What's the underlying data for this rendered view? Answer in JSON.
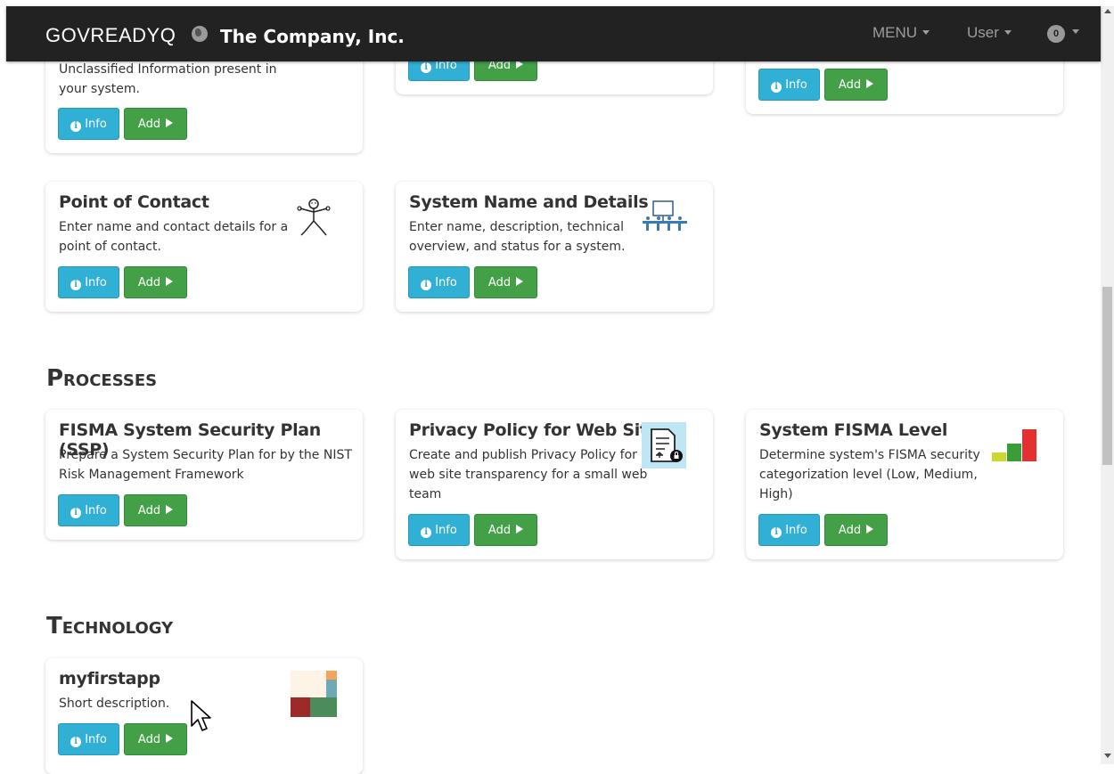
{
  "navbar": {
    "brand": "GOVREADYQ",
    "company": "The Company, Inc.",
    "menu_label": "MENU",
    "user_label": "User",
    "notifications_count": "0"
  },
  "buttons": {
    "info_label": "Info",
    "add_label": "Add"
  },
  "top_row": [
    {
      "desc_line1": "Unclassified Information present in",
      "desc_line2": "your system."
    }
  ],
  "row2": [
    {
      "title": "Point of Contact",
      "desc": [
        "Enter name and contact details for a",
        "point of contact."
      ],
      "icon": "stick-figure-icon"
    },
    {
      "title": "System Name and Details",
      "desc": [
        "Enter name, description, technical",
        "overview, and status for a system."
      ],
      "icon": "whiteboard-meeting-icon"
    }
  ],
  "sections": {
    "processes": "Processes",
    "technology": "Technology"
  },
  "processes": [
    {
      "title": "FISMA System Security Plan (SSP)",
      "desc": [
        "Prepare a System Security Plan for by the NIST",
        "Risk Management Framework"
      ]
    },
    {
      "title": "Privacy Policy for Web Site",
      "desc": [
        "Create and publish Privacy Policy for",
        "web site transparency for a small web",
        "team"
      ],
      "icon": "privacy-document-icon"
    },
    {
      "title": "System FISMA Level",
      "desc": [
        "Determine system's FISMA security",
        "categorization level (Low, Medium,",
        "High)"
      ],
      "icon": "level-bars-icon"
    }
  ],
  "technology": [
    {
      "title": "myfirstapp",
      "desc": [
        "Short description."
      ],
      "icon": "app-blocks-icon"
    }
  ],
  "colors": {
    "navbar": "#222222",
    "info_button": "#31b0d5",
    "add_button": "#43a047"
  }
}
